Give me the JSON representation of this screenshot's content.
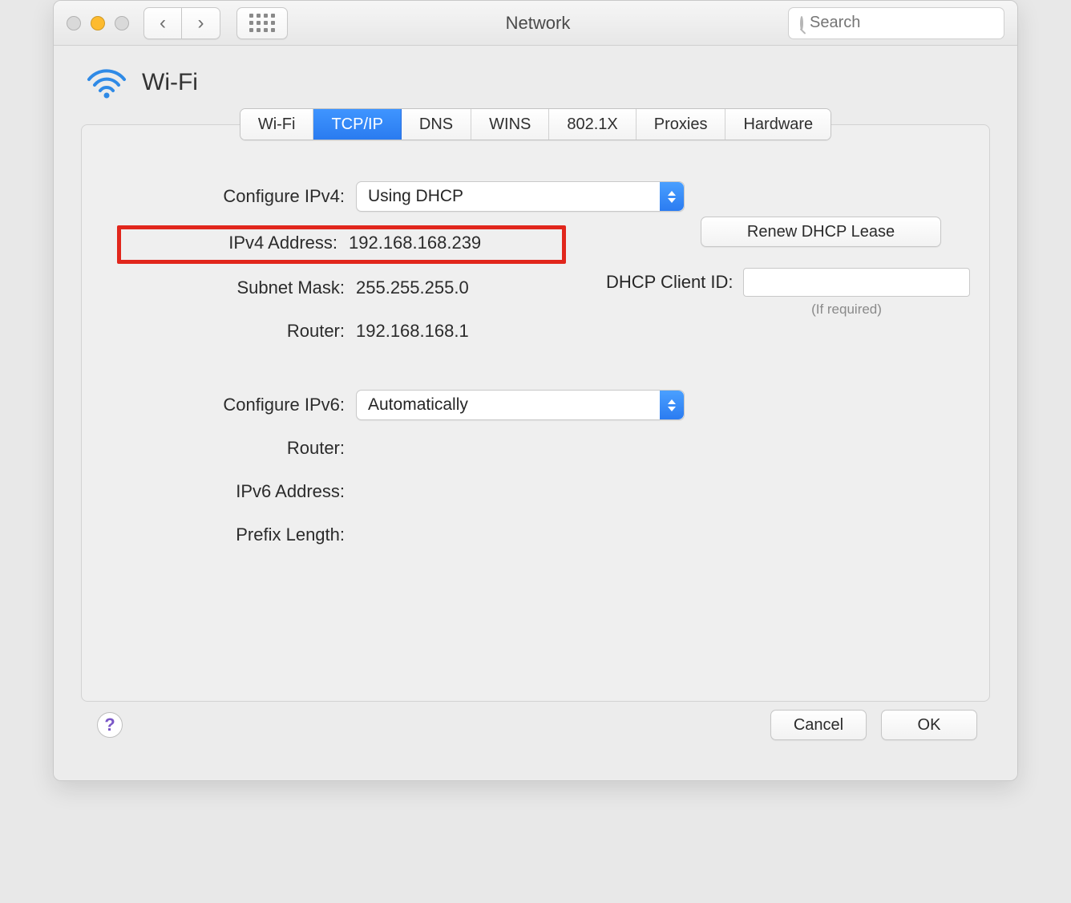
{
  "window": {
    "title": "Network",
    "search_placeholder": "Search"
  },
  "heading": {
    "title": "Wi-Fi"
  },
  "tabs": {
    "items": [
      "Wi-Fi",
      "TCP/IP",
      "DNS",
      "WINS",
      "802.1X",
      "Proxies",
      "Hardware"
    ],
    "active_index": 1
  },
  "ipv4": {
    "configure_label": "Configure IPv4:",
    "configure_value": "Using DHCP",
    "address_label": "IPv4 Address:",
    "address_value": "192.168.168.239",
    "subnet_label": "Subnet Mask:",
    "subnet_value": "255.255.255.0",
    "router_label": "Router:",
    "router_value": "192.168.168.1",
    "renew_label": "Renew DHCP Lease",
    "dhcp_client_id_label": "DHCP Client ID:",
    "dhcp_client_id_value": "",
    "dhcp_hint": "(If required)"
  },
  "ipv6": {
    "configure_label": "Configure IPv6:",
    "configure_value": "Automatically",
    "router_label": "Router:",
    "router_value": "",
    "address_label": "IPv6 Address:",
    "address_value": "",
    "prefix_label": "Prefix Length:",
    "prefix_value": ""
  },
  "footer": {
    "help": "?",
    "cancel": "Cancel",
    "ok": "OK"
  }
}
